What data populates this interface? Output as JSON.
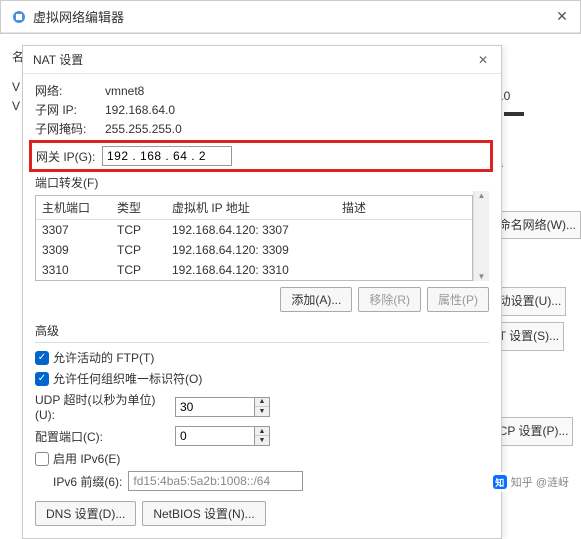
{
  "outer": {
    "title": "虚拟网络编辑器"
  },
  "right_fragments": {
    "ip_end": "7.0",
    "btn1": "命名网络(W)...",
    "btn2": "动设置(U)...",
    "btn3": "T 设置(S)...",
    "btn4": "CP 设置(P)...",
    "la": "la"
  },
  "overlap": {
    "l1": "名",
    "l2": "V",
    "l3": "V"
  },
  "dialog": {
    "title": "NAT 设置",
    "network_label": "网络:",
    "network_value": "vmnet8",
    "subnet_ip_label": "子网 IP:",
    "subnet_ip_value": "192.168.64.0",
    "mask_label": "子网掩码:",
    "mask_value": "255.255.255.0",
    "gateway_label": "网关 IP(G):",
    "gateway_value": "192 . 168 . 64 . 2",
    "port_fwd_label": "端口转发(F)",
    "table": {
      "headers": {
        "host_port": "主机端口",
        "type": "类型",
        "vm_ip": "虚拟机 IP 地址",
        "desc": "描述"
      },
      "rows": [
        {
          "host_port": "3307",
          "type": "TCP",
          "vm_ip": "192.168.64.120: 3307",
          "desc": ""
        },
        {
          "host_port": "3309",
          "type": "TCP",
          "vm_ip": "192.168.64.120: 3309",
          "desc": ""
        },
        {
          "host_port": "3310",
          "type": "TCP",
          "vm_ip": "192.168.64.120: 3310",
          "desc": ""
        }
      ]
    },
    "buttons": {
      "add": "添加(A)...",
      "remove": "移除(R)",
      "props": "属性(P)"
    },
    "advanced_title": "高级",
    "allow_ftp": "允许活动的 FTP(T)",
    "allow_oui": "允许任何组织唯一标识符(O)",
    "udp_label": "UDP 超时(以秒为单位)(U):",
    "udp_value": "30",
    "port_label": "配置端口(C):",
    "port_value": "0",
    "enable_ipv6": "启用 IPv6(E)",
    "ipv6_prefix_label": "IPv6 前缀(6):",
    "ipv6_prefix_value": "fd15:4ba5:5a2b:1008::/64",
    "dns_btn": "DNS 设置(D)...",
    "netbios_btn": "NetBIOS 设置(N)..."
  },
  "watermark": "知乎 @涟岈"
}
